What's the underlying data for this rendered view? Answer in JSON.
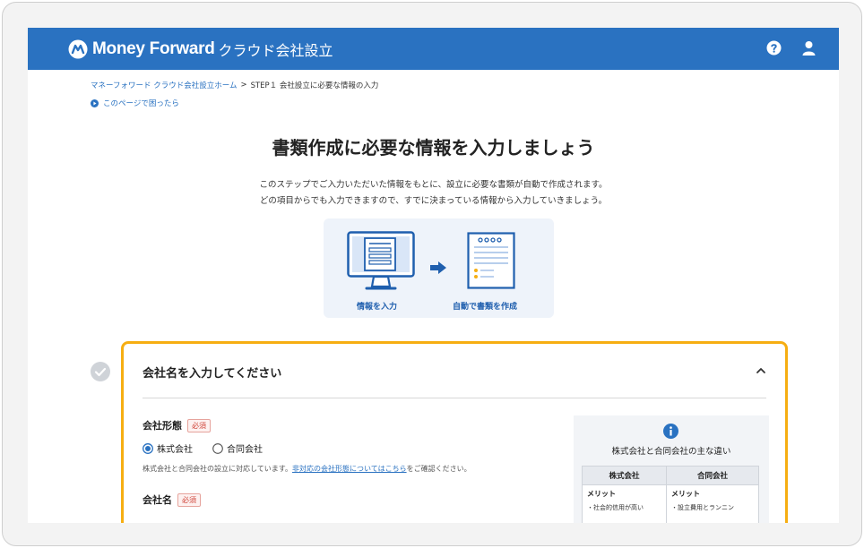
{
  "header": {
    "brand": "Money Forward",
    "product": "クラウド会社設立",
    "color": "#2a72c1"
  },
  "breadcrumb": {
    "home": "マネーフォワード クラウド会社設立ホーム",
    "separator": ">",
    "current": "STEP１ 会社設立に必要な情報の入力"
  },
  "help_link": "このページで困ったら",
  "page_title": "書類作成に必要な情報を入力しましょう",
  "intro": {
    "line1": "このステップでご入力いただいた情報をもとに、設立に必要な書類が自動で作成されます。",
    "line2": "どの項目からでも入力できますので、すでに決まっている情報から入力していきましょう。"
  },
  "illustration": {
    "left_label": "情報を入力",
    "right_label": "自動で書類を作成"
  },
  "card": {
    "title": "会社名を入力してください",
    "accent_color": "#f6ae12",
    "company_type": {
      "label": "会社形態",
      "required": "必須",
      "options": [
        {
          "label": "株式会社",
          "selected": true
        },
        {
          "label": "合同会社",
          "selected": false
        }
      ],
      "note_prefix": "株式会社と合同会社の設立に対応しています。",
      "note_link": "非対応の会社形態についてはこちら",
      "note_suffix": "をご確認ください。"
    },
    "company_name": {
      "label": "会社名",
      "required": "必須"
    },
    "info": {
      "title": "株式会社と合同会社の主な違い",
      "columns": [
        "株式会社",
        "合同会社"
      ],
      "merit_label": "メリット",
      "kabushiki_merits": [
        "社会的信用が高い"
      ],
      "godo_merits": [
        "設立費用とランニン"
      ]
    }
  }
}
